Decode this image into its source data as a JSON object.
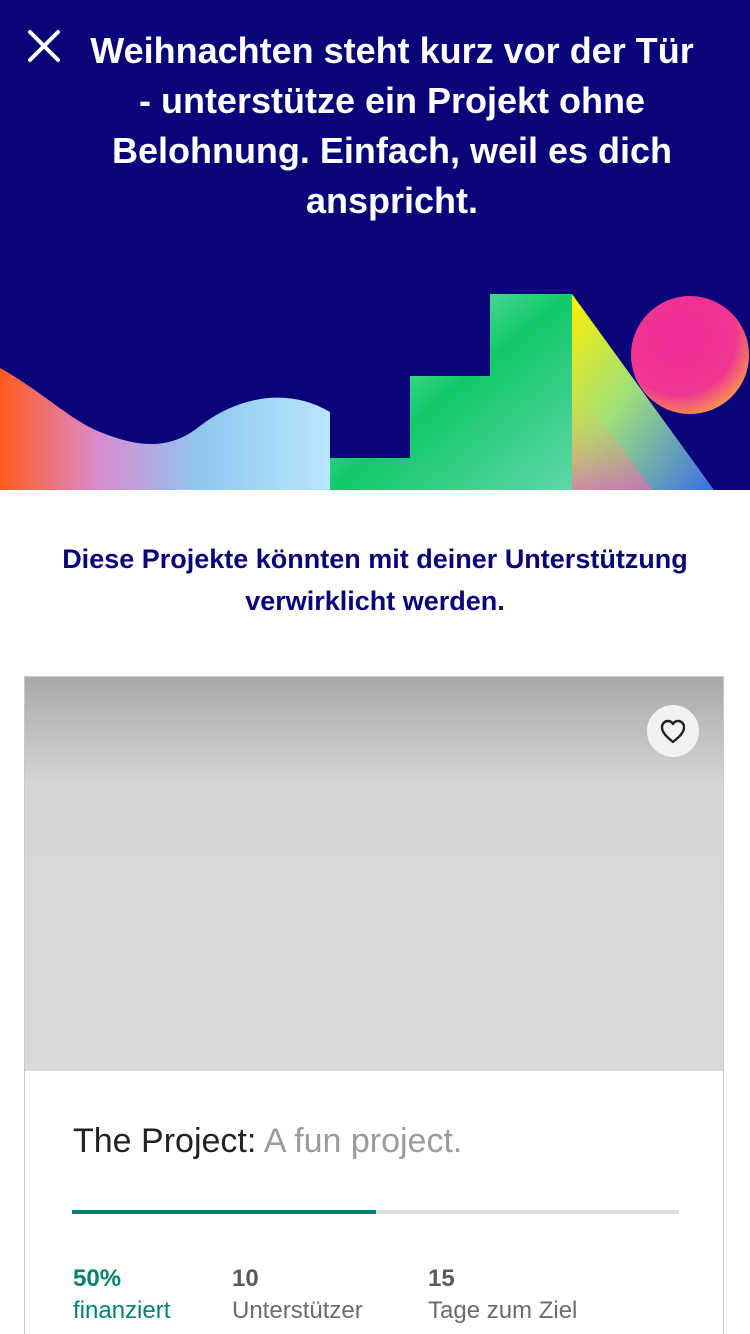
{
  "header": {
    "headline": "Weihnachten steht kurz vor der Tür - unterstütze ein Projekt ohne Belohnung. Einfach, weil es dich anspricht.",
    "background_color": "#0a047a"
  },
  "close_button": {
    "icon": "close-icon"
  },
  "subtitle": "Diese Projekte könnten mit deiner Unterstützung verwirklicht werden.",
  "project_card": {
    "name": "The Project:",
    "blurb": "A fun project.",
    "favorite_icon": "heart-outline-icon",
    "funding_progress": 0.5,
    "stats": {
      "funded_value": "50%",
      "funded_label": "finanziert",
      "backers_value": "10",
      "backers_label": "Unterstützer",
      "days_value": "15",
      "days_label": "Tage zum Ziel"
    }
  },
  "colors": {
    "accent_green": "#05826d",
    "brand_navy": "#0a047a"
  }
}
